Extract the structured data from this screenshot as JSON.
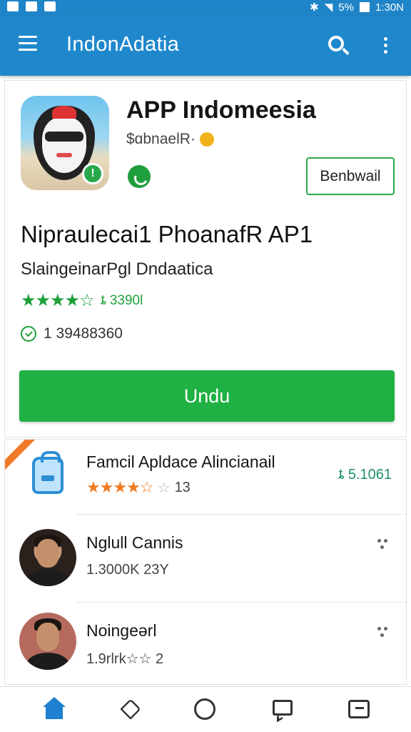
{
  "status_bar": {
    "battery": "5%",
    "time": "1:30N"
  },
  "app_bar": {
    "title": "IndonAdatia",
    "icons": [
      "menu-icon",
      "search-icon",
      "more-vert-icon"
    ]
  },
  "app": {
    "name": "APP Indomeesia",
    "developer": "$ɑbnaelR·",
    "follow_label": "Benbwail",
    "headline": "Nipraulecai1 PhoanafR AP1",
    "subtitle": "SlaingeinarPgl Dndaatica",
    "rating_stars": 4.5,
    "rating_text": "ȶ 3390l",
    "downloads": "1 39488360",
    "install_label": "Undu"
  },
  "list": {
    "items": [
      {
        "title": "Famcil Apldace Alincianail",
        "rating_stars": 3.5,
        "rating_count": "13",
        "price": "ȶ 5.1061",
        "icon": "backpack-icon"
      },
      {
        "title": "Nglull Cannis",
        "meta": "1.3000K 23Y",
        "icon": "avatar"
      },
      {
        "title": "Noingeərl",
        "meta": "1.9rlrk☆☆ 2",
        "icon": "avatar"
      }
    ]
  },
  "bottom_nav": {
    "items": [
      "home-icon",
      "badge-icon",
      "circle-icon",
      "chat-icon",
      "profile-icon"
    ],
    "active": "home-icon"
  },
  "colors": {
    "primary": "#1f88cd",
    "accent_green": "#1fb144",
    "star_orange": "#f07a1f"
  }
}
